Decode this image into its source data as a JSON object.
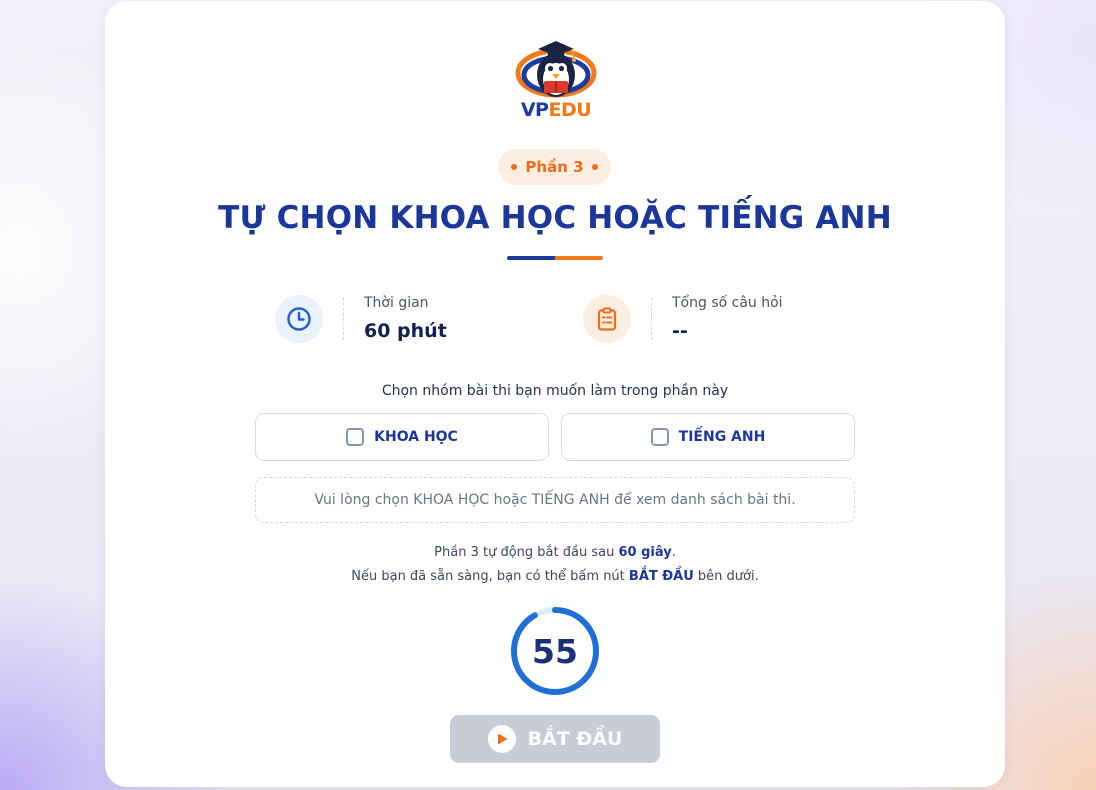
{
  "logo": {
    "brand_prefix": "VP",
    "brand_suffix": "EDU"
  },
  "section_badge": "Phần 3",
  "title": "TỰ CHỌN KHOA HỌC HOẶC TIẾNG ANH",
  "info": {
    "time": {
      "label": "Thời gian",
      "value": "60 phút",
      "icon": "clock-icon"
    },
    "questions": {
      "label": "Tổng số câu hỏi",
      "value": "--",
      "icon": "clipboard-icon"
    }
  },
  "group_prompt": "Chọn nhóm bài thi bạn muốn làm trong phần này",
  "options": [
    {
      "label": "KHOA HỌC",
      "checked": false
    },
    {
      "label": "TIẾNG ANH",
      "checked": false
    }
  ],
  "notice": "Vui lòng chọn KHOA HỌC hoặc TIẾNG ANH để xem danh sách bài thi.",
  "auto_start": {
    "line1_prefix": "Phần 3 tự động bắt đầu sau ",
    "line1_bold": "60 giây",
    "line1_suffix": ".",
    "line2_prefix": "Nếu bạn đã sẵn sàng, bạn có thể bấm nút ",
    "line2_bold": "BẮT ĐẦU",
    "line2_suffix": " bên dưới."
  },
  "countdown": {
    "value": "55",
    "remaining_fraction": 0.9167
  },
  "start_button": {
    "label": "BẮT ĐẦU",
    "disabled": true
  },
  "colors": {
    "primary": "#1b3799",
    "accent": "#f06c1b",
    "timer_ring": "#1f6fd6",
    "button_disabled": "#c7ccd6"
  }
}
